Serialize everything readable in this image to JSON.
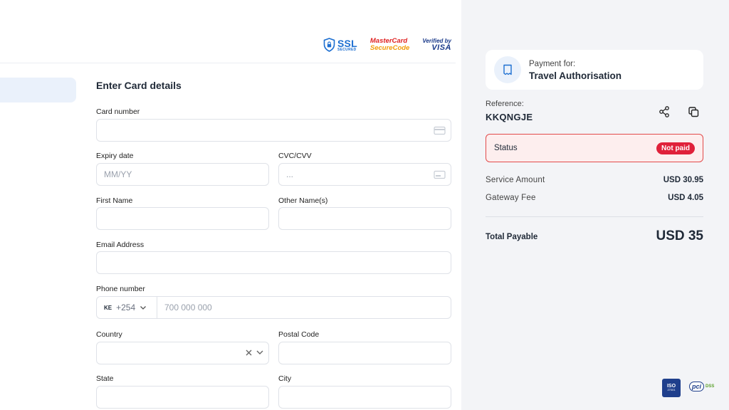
{
  "badges": {
    "ssl_big": "SSL",
    "ssl_small": "SECURED",
    "mastercard_line1": "MasterCard",
    "mastercard_line2": "SecureCode",
    "visa_line1": "Verified by",
    "visa_line2": "VISA"
  },
  "form": {
    "title": "Enter Card details",
    "card_number": {
      "label": "Card number",
      "value": "",
      "placeholder": ""
    },
    "expiry": {
      "label": "Expiry date",
      "value": "",
      "placeholder": "MM/YY"
    },
    "cvc": {
      "label": "CVC/CVV",
      "value": "",
      "placeholder": "..."
    },
    "first_name": {
      "label": "First Name",
      "value": ""
    },
    "other_names": {
      "label": "Other Name(s)",
      "value": ""
    },
    "email": {
      "label": "Email Address",
      "value": ""
    },
    "phone": {
      "label": "Phone number",
      "country_code": "KE",
      "dial_code": "+254",
      "placeholder": "700 000 000",
      "value": ""
    },
    "country": {
      "label": "Country",
      "value": ""
    },
    "postal_code": {
      "label": "Postal Code",
      "value": ""
    },
    "state": {
      "label": "State",
      "value": ""
    },
    "city": {
      "label": "City",
      "value": ""
    }
  },
  "summary": {
    "payment_for_label": "Payment for:",
    "payment_for_value": "Travel Authorisation",
    "reference_label": "Reference:",
    "reference_value": "KKQNGJE",
    "status_label": "Status",
    "status_value": "Not paid",
    "service_amount_label": "Service Amount",
    "service_amount_value": "USD 30.95",
    "gateway_fee_label": "Gateway Fee",
    "gateway_fee_value": "USD 4.05",
    "total_label": "Total Payable",
    "total_value": "USD 35"
  },
  "certs": {
    "iso_title": "ISO",
    "iso_number": "27001",
    "pci_title": "pci",
    "pci_sub": "DSS"
  },
  "colors": {
    "accent": "#1d6fd1",
    "status_border": "#e24a4a",
    "status_bg": "#fdeeee",
    "status_badge": "#e0213a",
    "right_panel_bg": "#f3f4f7"
  }
}
